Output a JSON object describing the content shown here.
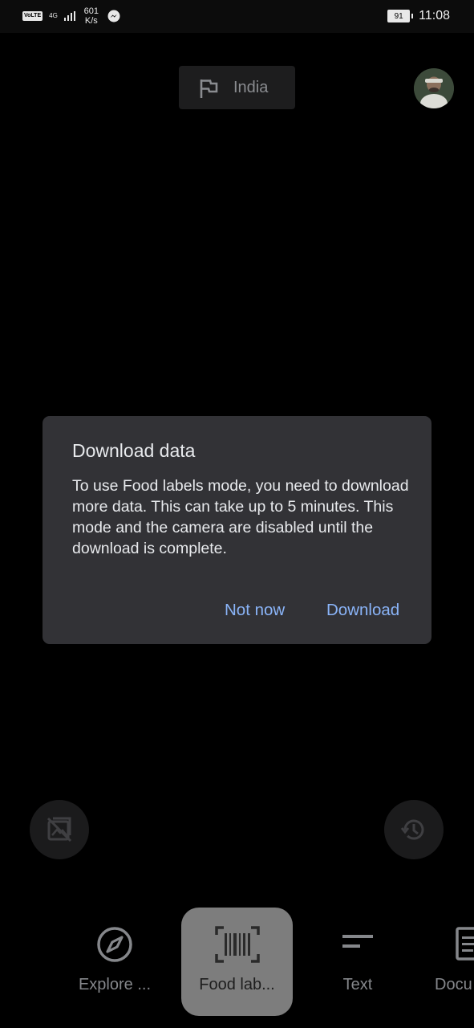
{
  "status_bar": {
    "volte": "VoLTE",
    "network": "4G",
    "speed_value": "601",
    "speed_unit": "K/s",
    "battery": "91",
    "time": "11:08"
  },
  "top": {
    "location_label": "India"
  },
  "dialog": {
    "title": "Download data",
    "body": "To use Food labels mode, you need to download more data. This can take up to 5 minutes. This mode and the camera are disabled until the download is complete.",
    "not_now_label": "Not now",
    "download_label": "Download"
  },
  "modes": [
    {
      "label": "Explore ...",
      "icon": "compass-icon"
    },
    {
      "label": "Food lab...",
      "icon": "barcode-icon",
      "selected": true
    },
    {
      "label": "Text",
      "icon": "text-icon"
    },
    {
      "label": "Docu",
      "icon": "document-icon"
    }
  ],
  "colors": {
    "accent": "#8ab4f8",
    "dialog_bg": "#323236",
    "selected_mode_bg": "#7d7d7d"
  }
}
